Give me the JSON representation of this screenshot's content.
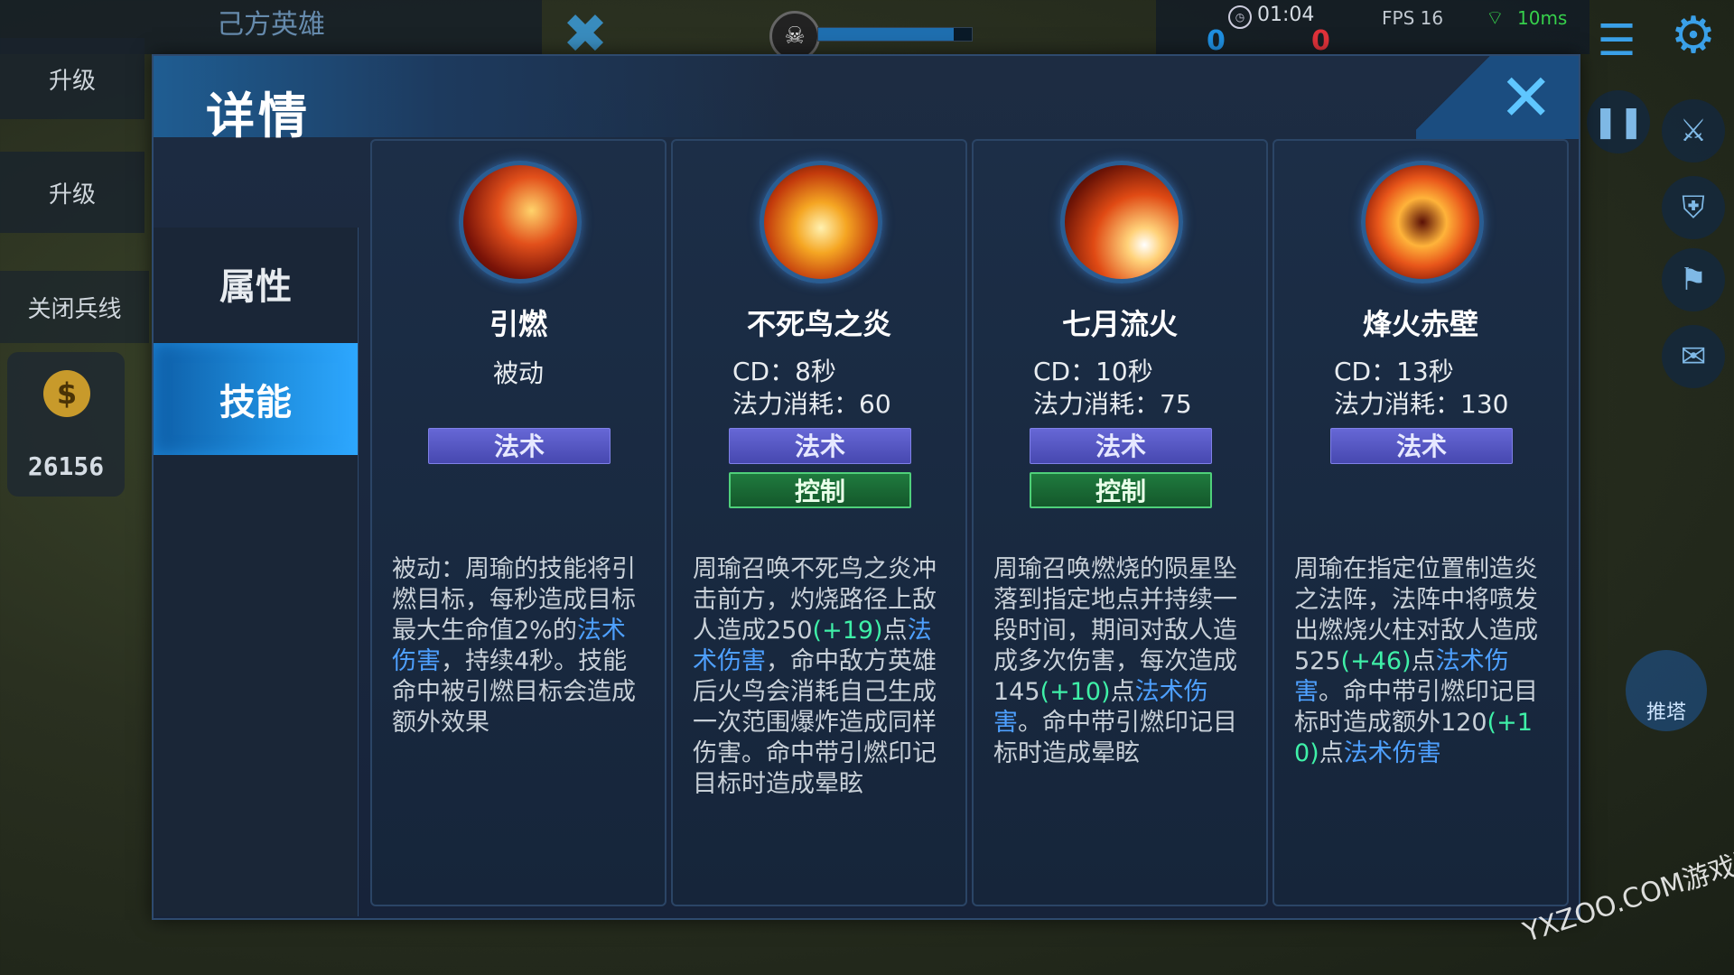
{
  "background": {
    "ally_title": "己方英雄",
    "side_buttons": [
      "升级",
      "升级"
    ],
    "close_minion": "关闭兵线",
    "gold": "26156",
    "game_time": "01:04",
    "fps": "FPS 16",
    "ping": "10ms",
    "score_left": "0",
    "score_right": "0",
    "push_tower": "推塔",
    "watermark": "YXZOO.COM游戏园",
    "colors": {
      "ally_score": "#1f8fe0",
      "enemy_score": "#e0323a"
    }
  },
  "modal": {
    "title": "详情",
    "tabs": [
      {
        "label": "属性",
        "active": false
      },
      {
        "label": "技能",
        "active": true
      }
    ]
  },
  "skills": [
    {
      "name": "引燃",
      "sub": "被动",
      "icon": "flame-comets-icon",
      "tags": [
        "法术"
      ],
      "desc": [
        {
          "t": "被动：周瑜的技能将引燃目标，每秒造成目标最大生命值2%的"
        },
        {
          "t": "法术伤害",
          "c": "blue"
        },
        {
          "t": "，持续4秒。技能命中被引燃目标会造成额外效果"
        }
      ]
    },
    {
      "name": "不死鸟之炎",
      "cd": "CD：8秒",
      "mana": "法力消耗：60",
      "icon": "phoenix-icon",
      "tags": [
        "法术",
        "控制"
      ],
      "desc": [
        {
          "t": "周瑜召唤不死鸟之炎冲击前方，灼烧路径上敌人造成250"
        },
        {
          "t": "(+19)",
          "c": "green"
        },
        {
          "t": "点"
        },
        {
          "t": "法术伤害",
          "c": "blue"
        },
        {
          "t": "，命中敌方英雄后火鸟会消耗自己生成一次范围爆炸造成同样伤害。命中带引燃印记目标时造成晕眩"
        }
      ]
    },
    {
      "name": "七月流火",
      "cd": "CD：10秒",
      "mana": "法力消耗：75",
      "icon": "meteor-icon",
      "tags": [
        "法术",
        "控制"
      ],
      "desc": [
        {
          "t": "周瑜召唤燃烧的陨星坠落到指定地点并持续一段时间，期间对敌人造成多次伤害，每次造成145"
        },
        {
          "t": "(+10)",
          "c": "green"
        },
        {
          "t": "点"
        },
        {
          "t": "法术伤害",
          "c": "blue"
        },
        {
          "t": "。命中带引燃印记目标时造成晕眩"
        }
      ]
    },
    {
      "name": "烽火赤壁",
      "cd": "CD：13秒",
      "mana": "法力消耗：130",
      "icon": "fire-ring-icon",
      "tags": [
        "法术"
      ],
      "desc": [
        {
          "t": "周瑜在指定位置制造炎之法阵，法阵中将喷发出燃烧火柱对敌人造成525"
        },
        {
          "t": "(+46)",
          "c": "green"
        },
        {
          "t": "点"
        },
        {
          "t": "法术伤害",
          "c": "blue"
        },
        {
          "t": "。命中带引燃印记目标时造成额外120"
        },
        {
          "t": "(+10)",
          "c": "green"
        },
        {
          "t": "点"
        },
        {
          "t": "法术伤害",
          "c": "blue"
        }
      ]
    }
  ]
}
